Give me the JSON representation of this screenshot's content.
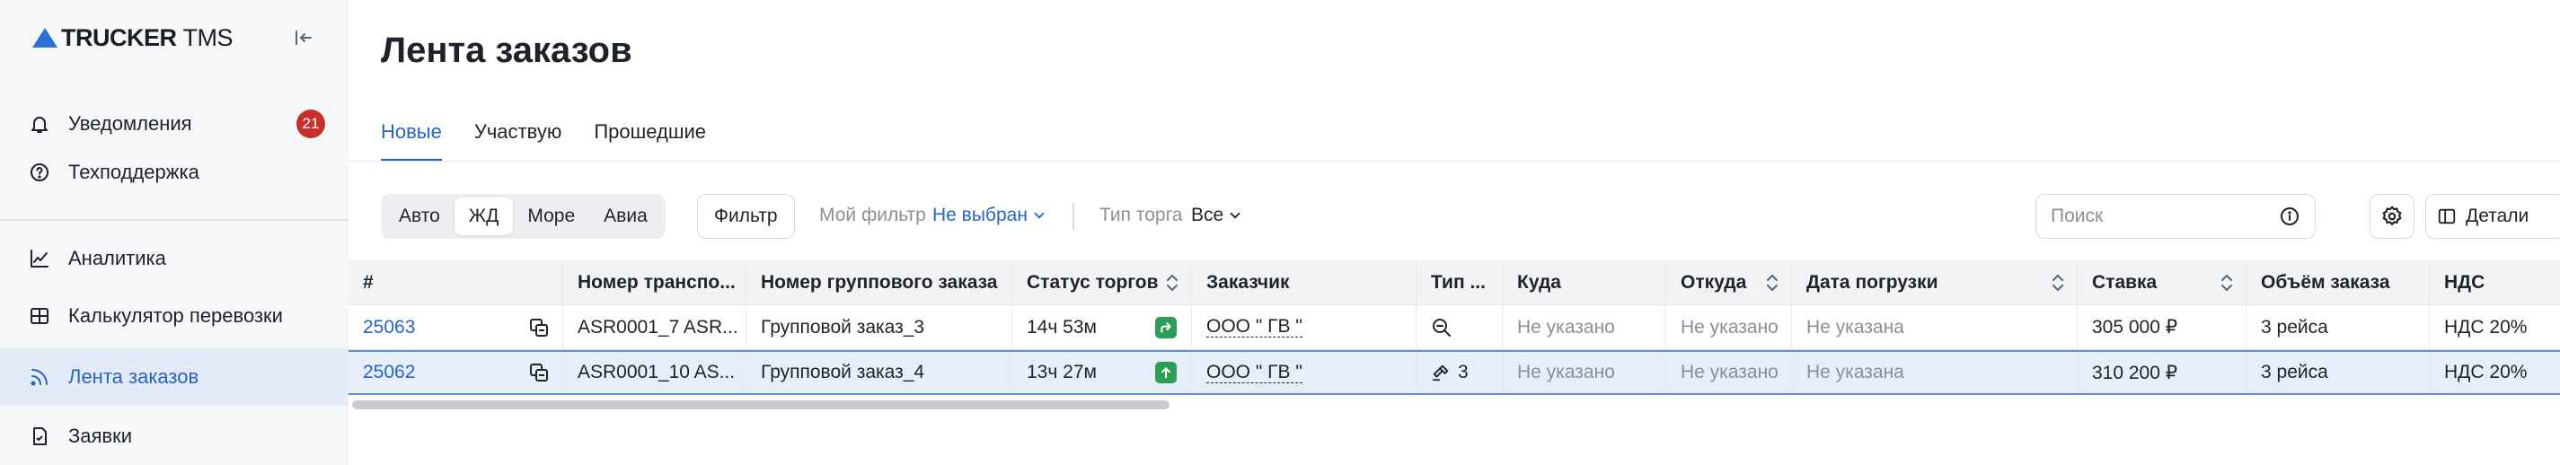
{
  "brand": {
    "name_bold": "TRUCKER",
    "name_light": "TMS"
  },
  "sidebar": {
    "items": [
      {
        "label": "Уведомления",
        "badge": "21",
        "icon": "bell-icon"
      },
      {
        "label": "Техподдержка",
        "icon": "help-circle-icon"
      },
      {
        "label": "Аналитика",
        "icon": "chart-line-icon"
      },
      {
        "label": "Калькулятор перевозки",
        "icon": "calculator-icon"
      },
      {
        "label": "Лента заказов",
        "icon": "rss-feed-icon",
        "active": true
      },
      {
        "label": "Заявки",
        "icon": "document-icon"
      }
    ]
  },
  "page": {
    "title": "Лента заказов"
  },
  "tabs": [
    {
      "label": "Новые",
      "active": true
    },
    {
      "label": "Участвую"
    },
    {
      "label": "Прошедшие"
    }
  ],
  "toolbar": {
    "transport_modes": [
      "Авто",
      "ЖД",
      "Море",
      "Авиа"
    ],
    "active_mode": "ЖД",
    "filter_button": "Фильтр",
    "my_filter_label": "Мой фильтр",
    "my_filter_value": "Не выбран",
    "trade_type_label": "Тип торга",
    "trade_type_value": "Все",
    "search_placeholder": "Поиск",
    "details_button": "Детали"
  },
  "table": {
    "columns": [
      "#",
      "Номер транспо...",
      "Номер группового заказа",
      "Статус торгов",
      "Заказчик",
      "Тип ...",
      "Куда",
      "Откуда",
      "Дата погрузки",
      "Ставка",
      "Объём заказа",
      "НДС"
    ],
    "rows": [
      {
        "id": "25063",
        "transport": "ASR0001_7 ASR...",
        "group": "Групповой заказ_3",
        "status": "14ч 53м",
        "customer": "ООО \" ГВ \"",
        "type": "",
        "to": "Не указано",
        "from": "Не указано",
        "date": "Не указана",
        "rate": "305 000 ₽",
        "volume": "3 рейса",
        "vat": "НДС 20%"
      },
      {
        "id": "25062",
        "transport": "ASR0001_10 AS...",
        "group": "Групповой заказ_4",
        "status": "13ч 27м",
        "customer": "ООО \" ГВ \"",
        "type": "3",
        "to": "Не указано",
        "from": "Не указано",
        "date": "Не указана",
        "rate": "310 200 ₽",
        "volume": "3 рейса",
        "vat": "НДС 20%"
      }
    ]
  },
  "colors": {
    "accent": "#2563c9",
    "badge": "#c9302c",
    "status_green": "#2e9e57",
    "sidebar_bg": "#f6f7f9"
  }
}
